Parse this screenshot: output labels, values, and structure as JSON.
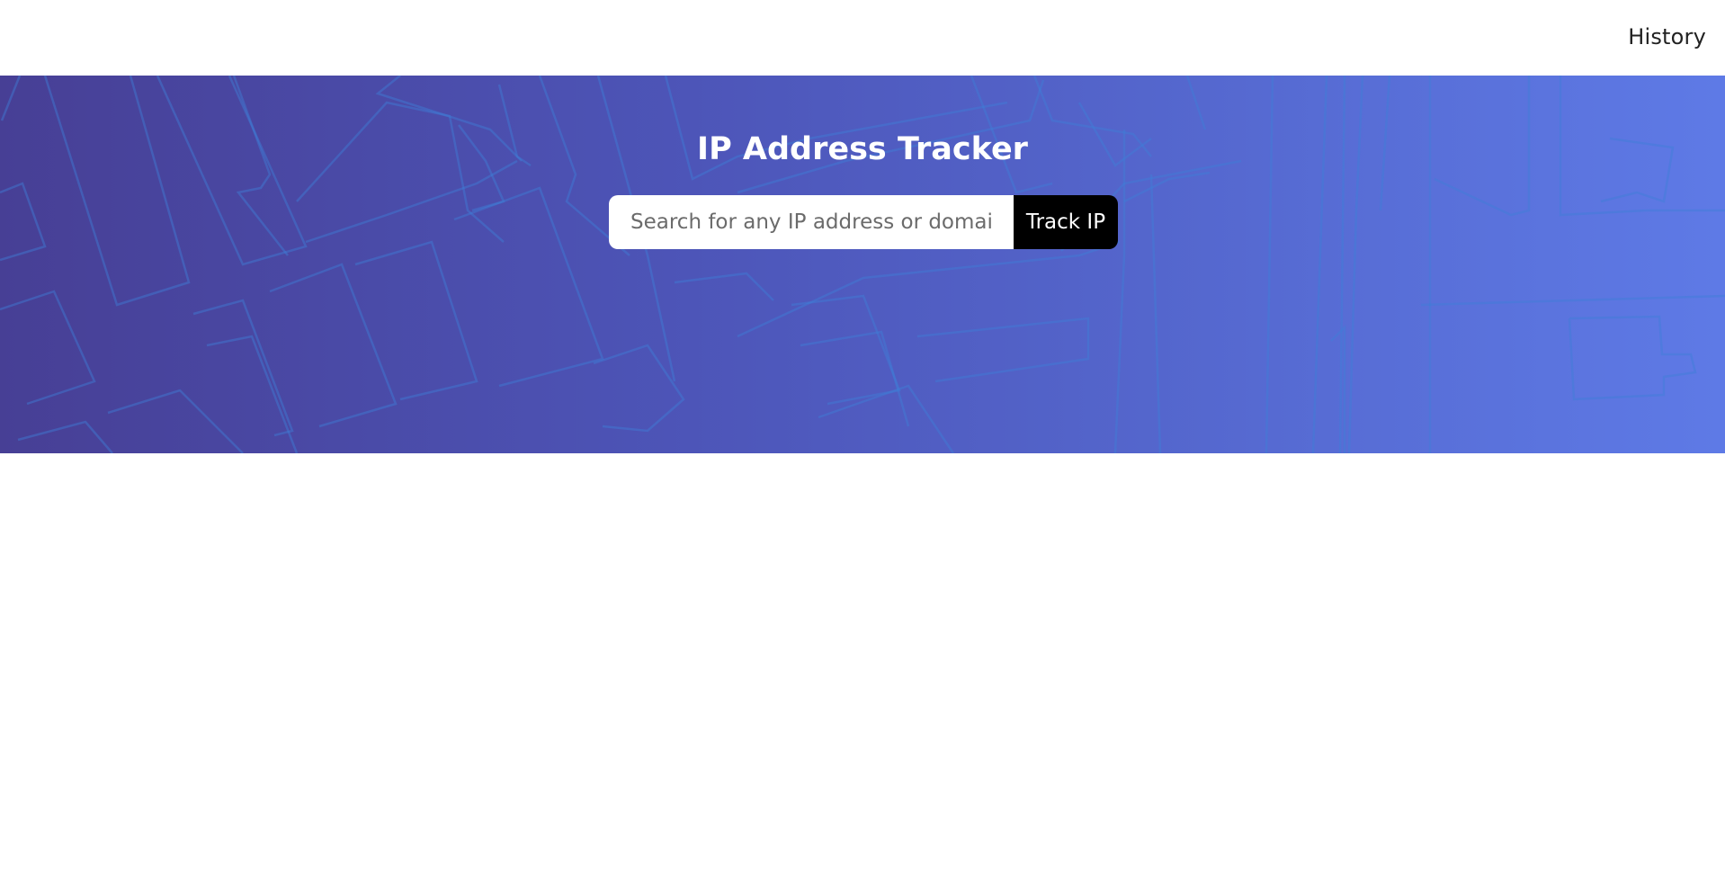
{
  "nav": {
    "history_label": "History"
  },
  "hero": {
    "title": "IP Address Tracker",
    "search": {
      "placeholder": "Search for any IP address or domain",
      "value": ""
    },
    "track_button_label": "Track IP"
  },
  "colors": {
    "hero_gradient_start": "#473f95",
    "hero_gradient_end": "#5e7ae6",
    "map_lines": "#3f7fd6",
    "button_bg": "#000000"
  }
}
